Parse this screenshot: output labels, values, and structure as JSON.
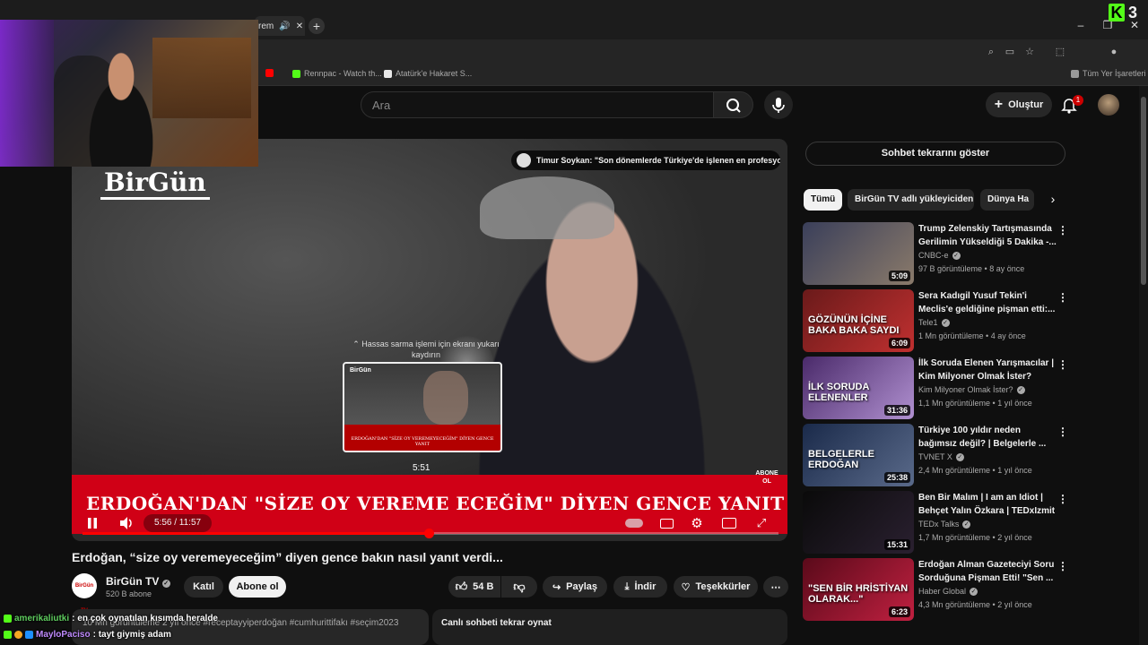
{
  "browser": {
    "active_tab_title": "rem",
    "bookmarks": [
      {
        "label": "",
        "color": "#ff0000"
      },
      {
        "label": "Rennpac - Watch th...",
        "color": "#53fc18"
      },
      {
        "label": "Atatürk'e Hakaret S...",
        "color": "#e8e8e8"
      },
      {
        "label": "Tüm Yer İşaretleri",
        "color": "#999999"
      }
    ],
    "corner_logo": {
      "letter": "K",
      "number": "3",
      "accent": "#53fc18"
    }
  },
  "youtube_header": {
    "search_placeholder": "Ara",
    "create_label": "Oluştur",
    "notification_count": "1"
  },
  "player": {
    "channel_watermark": "BirGün",
    "info_card_text": "Timur Soykan: \"Son dönemlerde Türkiye'de işlenen en profesyo...",
    "scroll_hint": "⌃ Hassas sarma işlemi için ekranı yukarı kaydırın",
    "preview_caption": "ERDOĞAN'DAN \"SİZE OY VEREMEYECEĞİM\" DİYEN GENCE YANIT",
    "preview_logo": "BirGün",
    "preview_time": "5:51",
    "lower_third": "ERDOĞAN'DAN \"SİZE OY VEREME ECEĞİM\" DİYEN GENCE YANIT",
    "subscribe_watermark": "ABONE OL",
    "time_display": "5:56 / 11:57",
    "progress_fraction": 0.498,
    "accent": "#ff0000",
    "lower_third_color": "#d00016"
  },
  "video": {
    "title": "Erdoğan, “size oy veremeyeceğim” diyen gence bakın nasıl yanıt verdi...",
    "channel_name": "BirGün TV",
    "channel_subs": "520 B abone",
    "channel_avatar_text": "BirGün TV",
    "join_label": "Katıl",
    "subscribe_label": "Abone ol",
    "like_count": "54 B",
    "share_label": "Paylaş",
    "download_label": "İndir",
    "thanks_label": "Teşekkürler",
    "description_preview": "10 Mn görüntüleme  2 yıl önce  #receptayyiperdoğan #cumhurittifakı #seçim2023",
    "chat_replay_label": "Canlı sohbeti tekrar oynat"
  },
  "chat_overlay": [
    {
      "user": "amerikaliutki",
      "message": ": en çok oynatılan kısımda heralde",
      "user_color": "#5ecb5e"
    },
    {
      "user": "MayloPaciso",
      "message": ": tayt giymiş adam",
      "user_color": "#c08bff"
    }
  ],
  "sidebar": {
    "show_chat_label": "Sohbet tekrarını göster",
    "chips": [
      "Tümü",
      "BirGün TV adlı yükleyiciden",
      "Dünya Ha"
    ],
    "recommendations": [
      {
        "title": "Trump Zelenskiy Tartışmasında Gerilimin Yükseldiği 5 Dakika -...",
        "channel": "CNBC-e",
        "meta": "97 B görüntüleme • 8 ay önce",
        "duration": "5:09",
        "thumb_colors": [
          "#3a3f5a",
          "#8a7a6a"
        ],
        "overlay": ""
      },
      {
        "title": "Sera Kadıgil Yusuf Tekin'i Meclis'e geldiğine pişman etti:...",
        "channel": "Tele1",
        "meta": "1 Mn görüntüleme • 4 ay önce",
        "duration": "6:09",
        "thumb_colors": [
          "#6a1a1a",
          "#c03030"
        ],
        "overlay": "GÖZÜNÜN İÇİNE BAKA BAKA SAYDI"
      },
      {
        "title": "İlk Soruda Elenen Yarışmacılar | Kim Milyoner Olmak İster?",
        "channel": "Kim Milyoner Olmak İster?",
        "meta": "1,1 Mn görüntüleme • 1 yıl önce",
        "duration": "31:36",
        "thumb_colors": [
          "#4a2a6a",
          "#b090d0"
        ],
        "overlay": "İLK SORUDA ELENENLER"
      },
      {
        "title": "Türkiye 100 yıldır neden bağımsız değil? | Belgelerle ...",
        "channel": "TVNET X",
        "meta": "2,4 Mn görüntüleme • 1 yıl önce",
        "duration": "25:38",
        "thumb_colors": [
          "#1a2a4a",
          "#5a6a8a"
        ],
        "overlay": "BELGELERLE ERDOĞAN"
      },
      {
        "title": "Ben Bir Malım | I am an Idiot | Behçet Yalın Özkara | TEDxIzmit",
        "channel": "TEDx Talks",
        "meta": "1,7 Mn görüntüleme • 2 yıl önce",
        "duration": "15:31",
        "thumb_colors": [
          "#0a0a0a",
          "#2a2030"
        ],
        "overlay": ""
      },
      {
        "title": "Erdoğan Alman Gazeteciyi Soru Sorduğuna Pişman Etti! \"Sen ...",
        "channel": "Haber Global",
        "meta": "4,3 Mn görüntüleme • 2 yıl önce",
        "duration": "6:23",
        "thumb_colors": [
          "#5a0a1a",
          "#c02040"
        ],
        "overlay": "\"SEN BİR HRİSTİYAN OLARAK...\""
      }
    ]
  }
}
